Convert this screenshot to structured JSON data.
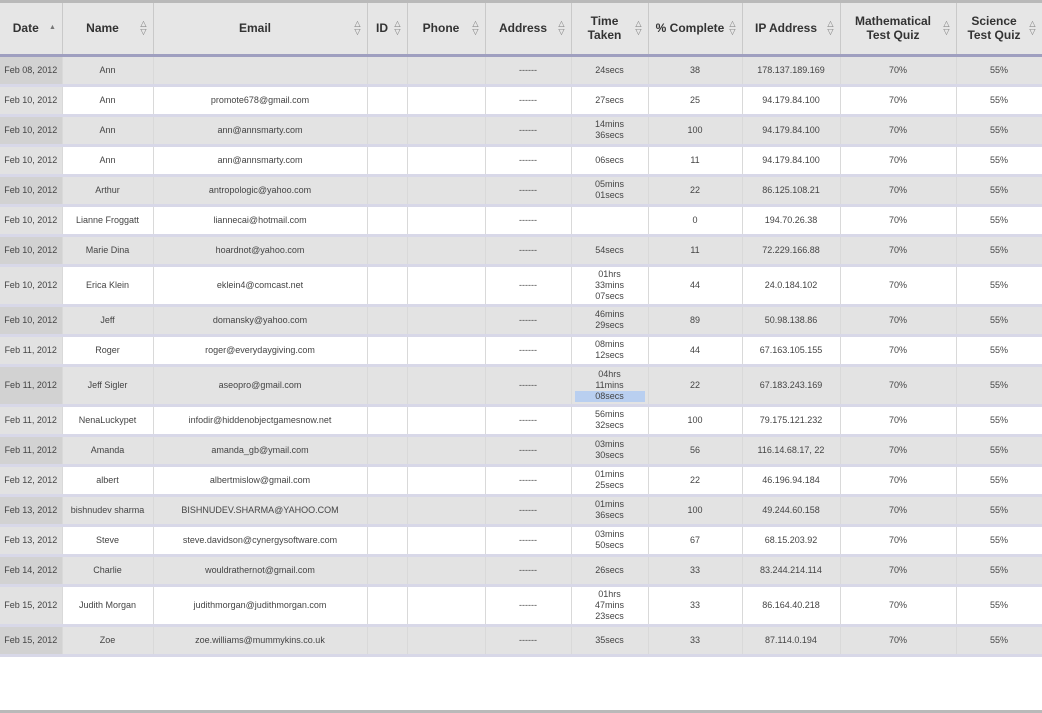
{
  "columns": [
    {
      "label": "Date",
      "active": true
    },
    {
      "label": "Name"
    },
    {
      "label": "Email"
    },
    {
      "label": "ID"
    },
    {
      "label": "Phone"
    },
    {
      "label": "Address"
    },
    {
      "label": "Time Taken"
    },
    {
      "label": "% Complete"
    },
    {
      "label": "IP Address"
    },
    {
      "label": "Mathematical Test Quiz"
    },
    {
      "label": "Science Test Quiz"
    }
  ],
  "rows": [
    {
      "date": "Feb 08, 2012",
      "name": "Ann",
      "email": "",
      "id": "",
      "phone": "",
      "address": "------",
      "time": "24secs",
      "pct": "38",
      "ip": "178.137.189.169",
      "math": "70%",
      "sci": "55%"
    },
    {
      "date": "Feb 10, 2012",
      "name": "Ann",
      "email": "promote678@gmail.com",
      "id": "",
      "phone": "",
      "address": "------",
      "time": "27secs",
      "pct": "25",
      "ip": "94.179.84.100",
      "math": "70%",
      "sci": "55%"
    },
    {
      "date": "Feb 10, 2012",
      "name": "Ann",
      "email": "ann@annsmarty.com",
      "id": "",
      "phone": "",
      "address": "------",
      "time": "14mins 36secs",
      "pct": "100",
      "ip": "94.179.84.100",
      "math": "70%",
      "sci": "55%"
    },
    {
      "date": "Feb 10, 2012",
      "name": "Ann",
      "email": "ann@annsmarty.com",
      "id": "",
      "phone": "",
      "address": "------",
      "time": "06secs",
      "pct": "11",
      "ip": "94.179.84.100",
      "math": "70%",
      "sci": "55%"
    },
    {
      "date": "Feb 10, 2012",
      "name": "Arthur",
      "email": "antropologic@yahoo.com",
      "id": "",
      "phone": "",
      "address": "------",
      "time": "05mins 01secs",
      "pct": "22",
      "ip": "86.125.108.21",
      "math": "70%",
      "sci": "55%"
    },
    {
      "date": "Feb 10, 2012",
      "name": "Lianne Froggatt",
      "email": "liannecai@hotmail.com",
      "id": "",
      "phone": "",
      "address": "------",
      "time": "",
      "pct": "0",
      "ip": "194.70.26.38",
      "math": "70%",
      "sci": "55%"
    },
    {
      "date": "Feb 10, 2012",
      "name": "Marie Dina",
      "email": "hoardnot@yahoo.com",
      "id": "",
      "phone": "",
      "address": "------",
      "time": "54secs",
      "pct": "11",
      "ip": "72.229.166.88",
      "math": "70%",
      "sci": "55%"
    },
    {
      "date": "Feb 10, 2012",
      "name": "Erica Klein",
      "email": "eklein4@comcast.net",
      "id": "",
      "phone": "",
      "address": "------",
      "time": "01hrs 33mins 07secs",
      "pct": "44",
      "ip": "24.0.184.102",
      "math": "70%",
      "sci": "55%"
    },
    {
      "date": "Feb 10, 2012",
      "name": "Jeff",
      "email": "domansky@yahoo.com",
      "id": "",
      "phone": "",
      "address": "------",
      "time": "46mins 29secs",
      "pct": "89",
      "ip": "50.98.138.86",
      "math": "70%",
      "sci": "55%"
    },
    {
      "date": "Feb 11, 2012",
      "name": "Roger",
      "email": "roger@everydaygiving.com",
      "id": "",
      "phone": "",
      "address": "------",
      "time": "08mins 12secs",
      "pct": "44",
      "ip": "67.163.105.155",
      "math": "70%",
      "sci": "55%"
    },
    {
      "date": "Feb 11, 2012",
      "name": "Jeff Sigler",
      "email": "aseopro@gmail.com",
      "id": "",
      "phone": "",
      "address": "------",
      "time": "04hrs 11mins 08secs",
      "pct": "22",
      "ip": "67.183.243.169",
      "math": "70%",
      "sci": "55%",
      "hl_last": true
    },
    {
      "date": "Feb 11, 2012",
      "name": "NenaLuckypet",
      "email": "infodir@hiddenobjectgamesnow.net",
      "id": "",
      "phone": "",
      "address": "------",
      "time": "56mins 32secs",
      "pct": "100",
      "ip": "79.175.121.232",
      "math": "70%",
      "sci": "55%"
    },
    {
      "date": "Feb 11, 2012",
      "name": "Amanda",
      "email": "amanda_gb@ymail.com",
      "id": "",
      "phone": "",
      "address": "------",
      "time": "03mins 30secs",
      "pct": "56",
      "ip": "116.14.68.17, 22",
      "math": "70%",
      "sci": "55%"
    },
    {
      "date": "Feb 12, 2012",
      "name": "albert",
      "email": "albertmislow@gmail.com",
      "id": "",
      "phone": "",
      "address": "------",
      "time": "01mins 25secs",
      "pct": "22",
      "ip": "46.196.94.184",
      "math": "70%",
      "sci": "55%"
    },
    {
      "date": "Feb 13, 2012",
      "name": "bishnudev sharma",
      "email": "BISHNUDEV.SHARMA@YAHOO.COM",
      "id": "",
      "phone": "",
      "address": "------",
      "time": "01mins 36secs",
      "pct": "100",
      "ip": "49.244.60.158",
      "math": "70%",
      "sci": "55%"
    },
    {
      "date": "Feb 13, 2012",
      "name": "Steve",
      "email": "steve.davidson@cynergysoftware.com",
      "id": "",
      "phone": "",
      "address": "------",
      "time": "03mins 50secs",
      "pct": "67",
      "ip": "68.15.203.92",
      "math": "70%",
      "sci": "55%"
    },
    {
      "date": "Feb 14, 2012",
      "name": "Charlie",
      "email": "wouldrathernot@gmail.com",
      "id": "",
      "phone": "",
      "address": "------",
      "time": "26secs",
      "pct": "33",
      "ip": "83.244.214.114",
      "math": "70%",
      "sci": "55%"
    },
    {
      "date": "Feb 15, 2012",
      "name": "Judith Morgan",
      "email": "judithmorgan@judithmorgan.com",
      "id": "",
      "phone": "",
      "address": "------",
      "time": "01hrs 47mins 23secs",
      "pct": "33",
      "ip": "86.164.40.218",
      "math": "70%",
      "sci": "55%"
    },
    {
      "date": "Feb 15, 2012",
      "name": "Zoe",
      "email": "zoe.williams@mummykins.co.uk",
      "id": "",
      "phone": "",
      "address": "------",
      "time": "35secs",
      "pct": "33",
      "ip": "87.114.0.194",
      "math": "70%",
      "sci": "55%"
    }
  ]
}
